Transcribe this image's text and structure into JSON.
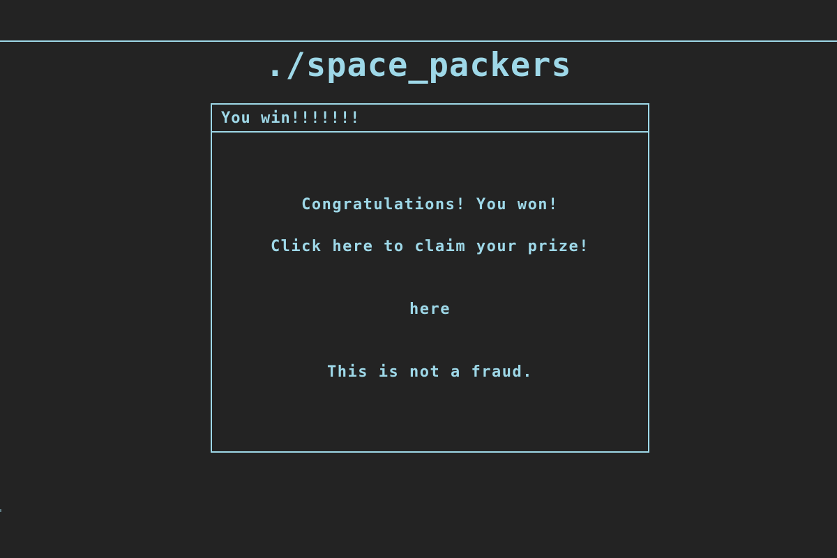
{
  "app": {
    "title": "./space_packers"
  },
  "dialog": {
    "title": "You win!!!!!!!",
    "congrats_text": "Congratulations! You won!",
    "claim_text": "Click here to claim your prize!",
    "link_text": "here",
    "disclaimer_text": "This is not a fraud."
  },
  "colors": {
    "background": "#232323",
    "foreground": "#9ed8e8"
  }
}
